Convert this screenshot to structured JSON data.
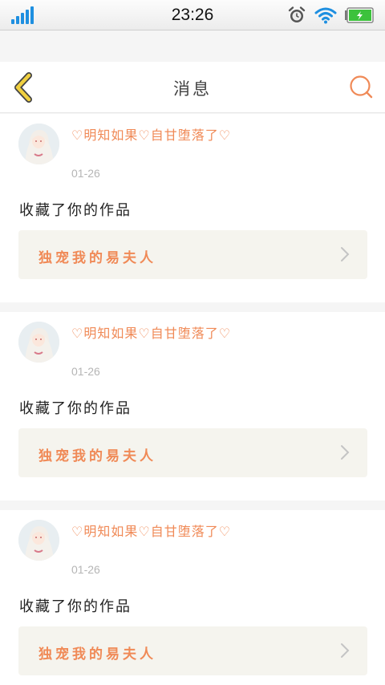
{
  "status_bar": {
    "time": "23:26",
    "icons": [
      "signal-icon",
      "alarm-clock-icon",
      "wifi-icon",
      "battery-charging-icon"
    ],
    "signal_color": "#1e8fe0",
    "battery_color": "#3cc23c"
  },
  "header": {
    "title": "消息",
    "back_icon": "chevron-left-icon",
    "search_icon": "search-icon",
    "back_color": "#f0d040",
    "accent_color": "#f08a57"
  },
  "messages": [
    {
      "username": "♡明知如果♡自甘堕落了♡",
      "date": "01-26",
      "action": "收藏了你的作品",
      "work_title": "独宠我的易夫人"
    },
    {
      "username": "♡明知如果♡自甘堕落了♡",
      "date": "01-26",
      "action": "收藏了你的作品",
      "work_title": "独宠我的易夫人"
    },
    {
      "username": "♡明知如果♡自甘堕落了♡",
      "date": "01-26",
      "action": "收藏了你的作品",
      "work_title": "独宠我的易夫人"
    }
  ]
}
